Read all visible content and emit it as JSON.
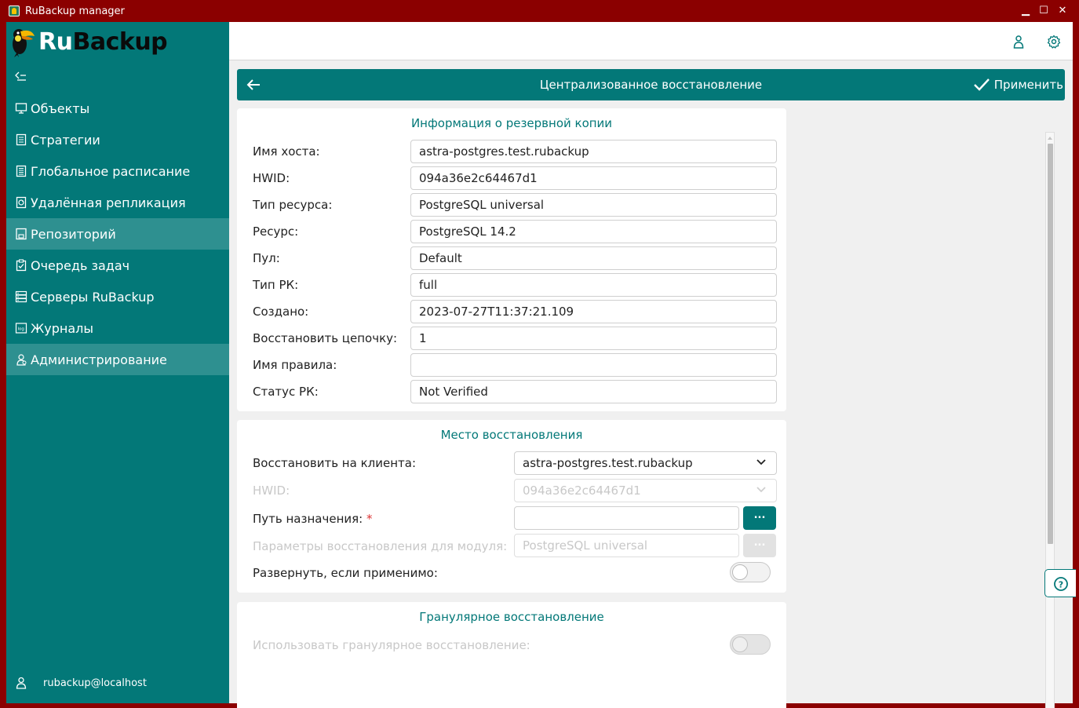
{
  "window": {
    "title": "RuBackup manager"
  },
  "brand": {
    "part1": "Ru",
    "part2": "Backup"
  },
  "sidebar": {
    "items": [
      {
        "label": "Объекты",
        "icon": "monitor-icon"
      },
      {
        "label": "Стратегии",
        "icon": "document-icon"
      },
      {
        "label": "Глобальное расписание",
        "icon": "document-list-icon"
      },
      {
        "label": "Удалённая репликация",
        "icon": "replication-icon"
      },
      {
        "label": "Репозиторий",
        "icon": "repository-icon",
        "active": true
      },
      {
        "label": "Очередь задач",
        "icon": "task-queue-icon"
      },
      {
        "label": "Серверы RuBackup",
        "icon": "server-icon"
      },
      {
        "label": "Журналы",
        "icon": "log-icon"
      },
      {
        "label": "Администрирование",
        "icon": "admin-icon",
        "highlighted": true
      }
    ],
    "user": "rubackup@localhost"
  },
  "header": {
    "title": "Централизованное восстановление",
    "apply_label": "Применить"
  },
  "backup_info": {
    "title": "Информация о резервной копии",
    "rows": [
      {
        "label": "Имя хоста:",
        "value": "astra-postgres.test.rubackup"
      },
      {
        "label": "HWID:",
        "value": "094a36e2c64467d1"
      },
      {
        "label": "Тип ресурса:",
        "value": "PostgreSQL universal"
      },
      {
        "label": "Ресурс:",
        "value": "PostgreSQL 14.2"
      },
      {
        "label": "Пул:",
        "value": "Default"
      },
      {
        "label": "Тип РК:",
        "value": "full"
      },
      {
        "label": "Создано:",
        "value": "2023-07-27T11:37:21.109"
      },
      {
        "label": "Восстановить цепочку:",
        "value": "1"
      },
      {
        "label": "Имя правила:",
        "value": ""
      },
      {
        "label": "Статус РК:",
        "value": "Not Verified"
      }
    ]
  },
  "restore_location": {
    "title": "Место восстановления",
    "client_label": "Восстановить на клиента:",
    "client_value": "astra-postgres.test.rubackup",
    "hwid_label": "HWID:",
    "hwid_value": "094a36e2c64467d1",
    "path_label": "Путь назначения:",
    "path_required_mark": "*",
    "path_value": "",
    "path_button": "...",
    "module_params_label": "Параметры восстановления для модуля:",
    "module_params_value": "PostgreSQL universal",
    "module_params_button": "...",
    "deploy_label": "Развернуть, если применимо:",
    "deploy_enabled": false
  },
  "granular": {
    "title": "Гранулярное восстановление",
    "use_label": "Использовать гранулярное восстановление:",
    "use_enabled": false
  },
  "colors": {
    "accent": "#037878",
    "frame": "#8b0000",
    "background": "#f0f0f0"
  }
}
